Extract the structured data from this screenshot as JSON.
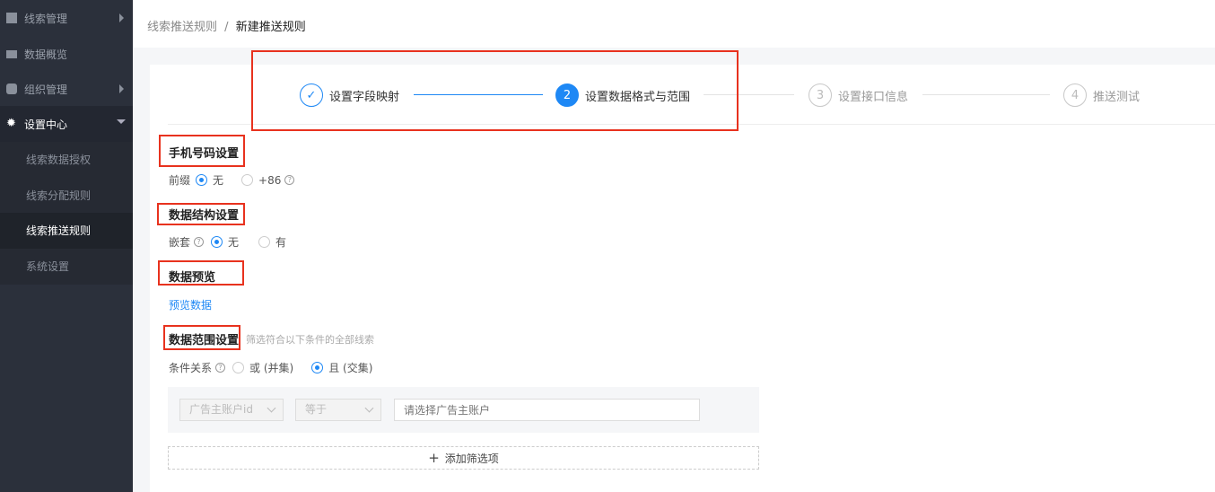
{
  "sidebar": {
    "items": [
      {
        "label": "线索管理",
        "icon": "book-icon"
      },
      {
        "label": "数据概览",
        "icon": "chart-icon"
      },
      {
        "label": "组织管理",
        "icon": "cube-icon"
      },
      {
        "label": "设置中心",
        "icon": "gear-icon"
      }
    ],
    "subitems": [
      {
        "label": "线索数据授权"
      },
      {
        "label": "线索分配规则"
      },
      {
        "label": "线索推送规则"
      },
      {
        "label": "系统设置"
      }
    ]
  },
  "breadcrumb": {
    "parent": "线索推送规则",
    "sep": "/",
    "current": "新建推送规则"
  },
  "steps": [
    {
      "num": "✓",
      "label": "设置字段映射"
    },
    {
      "num": "2",
      "label": "设置数据格式与范围"
    },
    {
      "num": "3",
      "label": "设置接口信息"
    },
    {
      "num": "4",
      "label": "推送测试"
    }
  ],
  "phone": {
    "title": "手机号码设置",
    "label": "前缀",
    "opt1": "无",
    "opt2": "+86",
    "help": "?"
  },
  "structure": {
    "title": "数据结构设置",
    "label": "嵌套",
    "opt1": "无",
    "opt2": "有",
    "help": "?"
  },
  "preview": {
    "title": "数据预览",
    "link": "预览数据"
  },
  "range": {
    "title": "数据范围设置",
    "hint": "筛选符合以下条件的全部线索",
    "label": "条件关系",
    "opt1": "或 (并集)",
    "opt2": "且 (交集)",
    "help": "?",
    "field": "广告主账户id",
    "op": "等于",
    "placeholder": "请选择广告主账户",
    "add": "添加筛选项",
    "plus": "+"
  },
  "colors": {
    "accent": "#1e88f5",
    "highlight": "#e8321e"
  }
}
